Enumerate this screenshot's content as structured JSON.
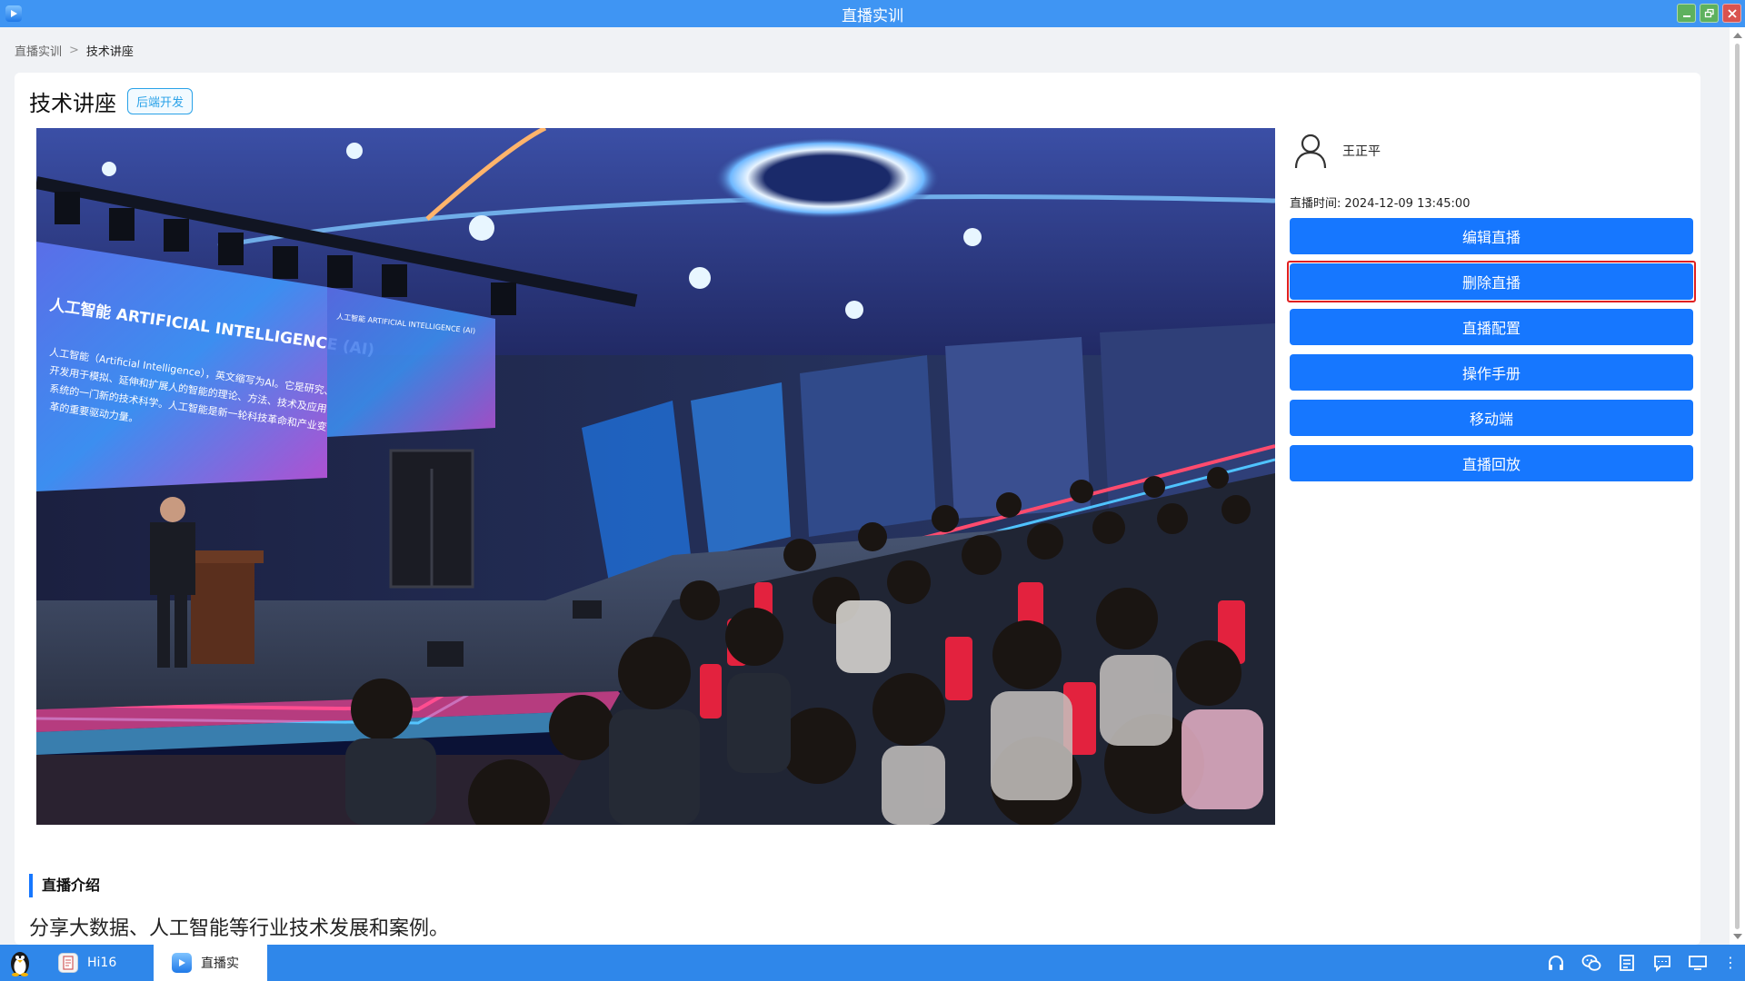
{
  "window": {
    "title": "直播实训"
  },
  "breadcrumb": {
    "root": "直播实训",
    "separator": ">",
    "current": "技术讲座"
  },
  "header": {
    "title": "技术讲座",
    "tag": "后端开发"
  },
  "hero": {
    "screen_title_left": "人工智能 ARTIFICIAL INTELLIGENCE (AI)",
    "screen_text_left": [
      "人工智能（Artificial Intelligence），英文缩写为AI。它是研究、",
      "开发用于模拟、延伸和扩展人的智能的理论、方法、技术及应用",
      "系统的一门新的技术科学。人工智能是新一轮科技革命和产业变",
      "革的重要驱动力量。"
    ],
    "screen_title_right": "人工智能 ARTIFICIAL INTELLIGENCE (AI)"
  },
  "side": {
    "host_name": "王正平",
    "time_label": "直播时间:",
    "time_value": "2024-12-09 13:45:00",
    "buttons": [
      "编辑直播",
      "删除直播",
      "直播配置",
      "操作手册",
      "移动端",
      "直播回放"
    ]
  },
  "intro": {
    "title": "直播介绍",
    "text": "分享大数据、人工智能等行业技术发展和案例。"
  },
  "taskbar": {
    "items": [
      {
        "label": "Hi16",
        "icon": "document-icon"
      },
      {
        "label": "直播实",
        "icon": "live-play-icon"
      }
    ],
    "tray_icons": [
      "headset-icon",
      "wechat-icon",
      "notes-icon",
      "chat-icon",
      "monitor-icon"
    ],
    "more": "⋮"
  },
  "colors": {
    "titlebar": "#3f95f3",
    "primary_button": "#1677ff",
    "highlight_border": "#e02020",
    "tag": "#2aa2e8",
    "taskbar": "#2f87ea"
  }
}
